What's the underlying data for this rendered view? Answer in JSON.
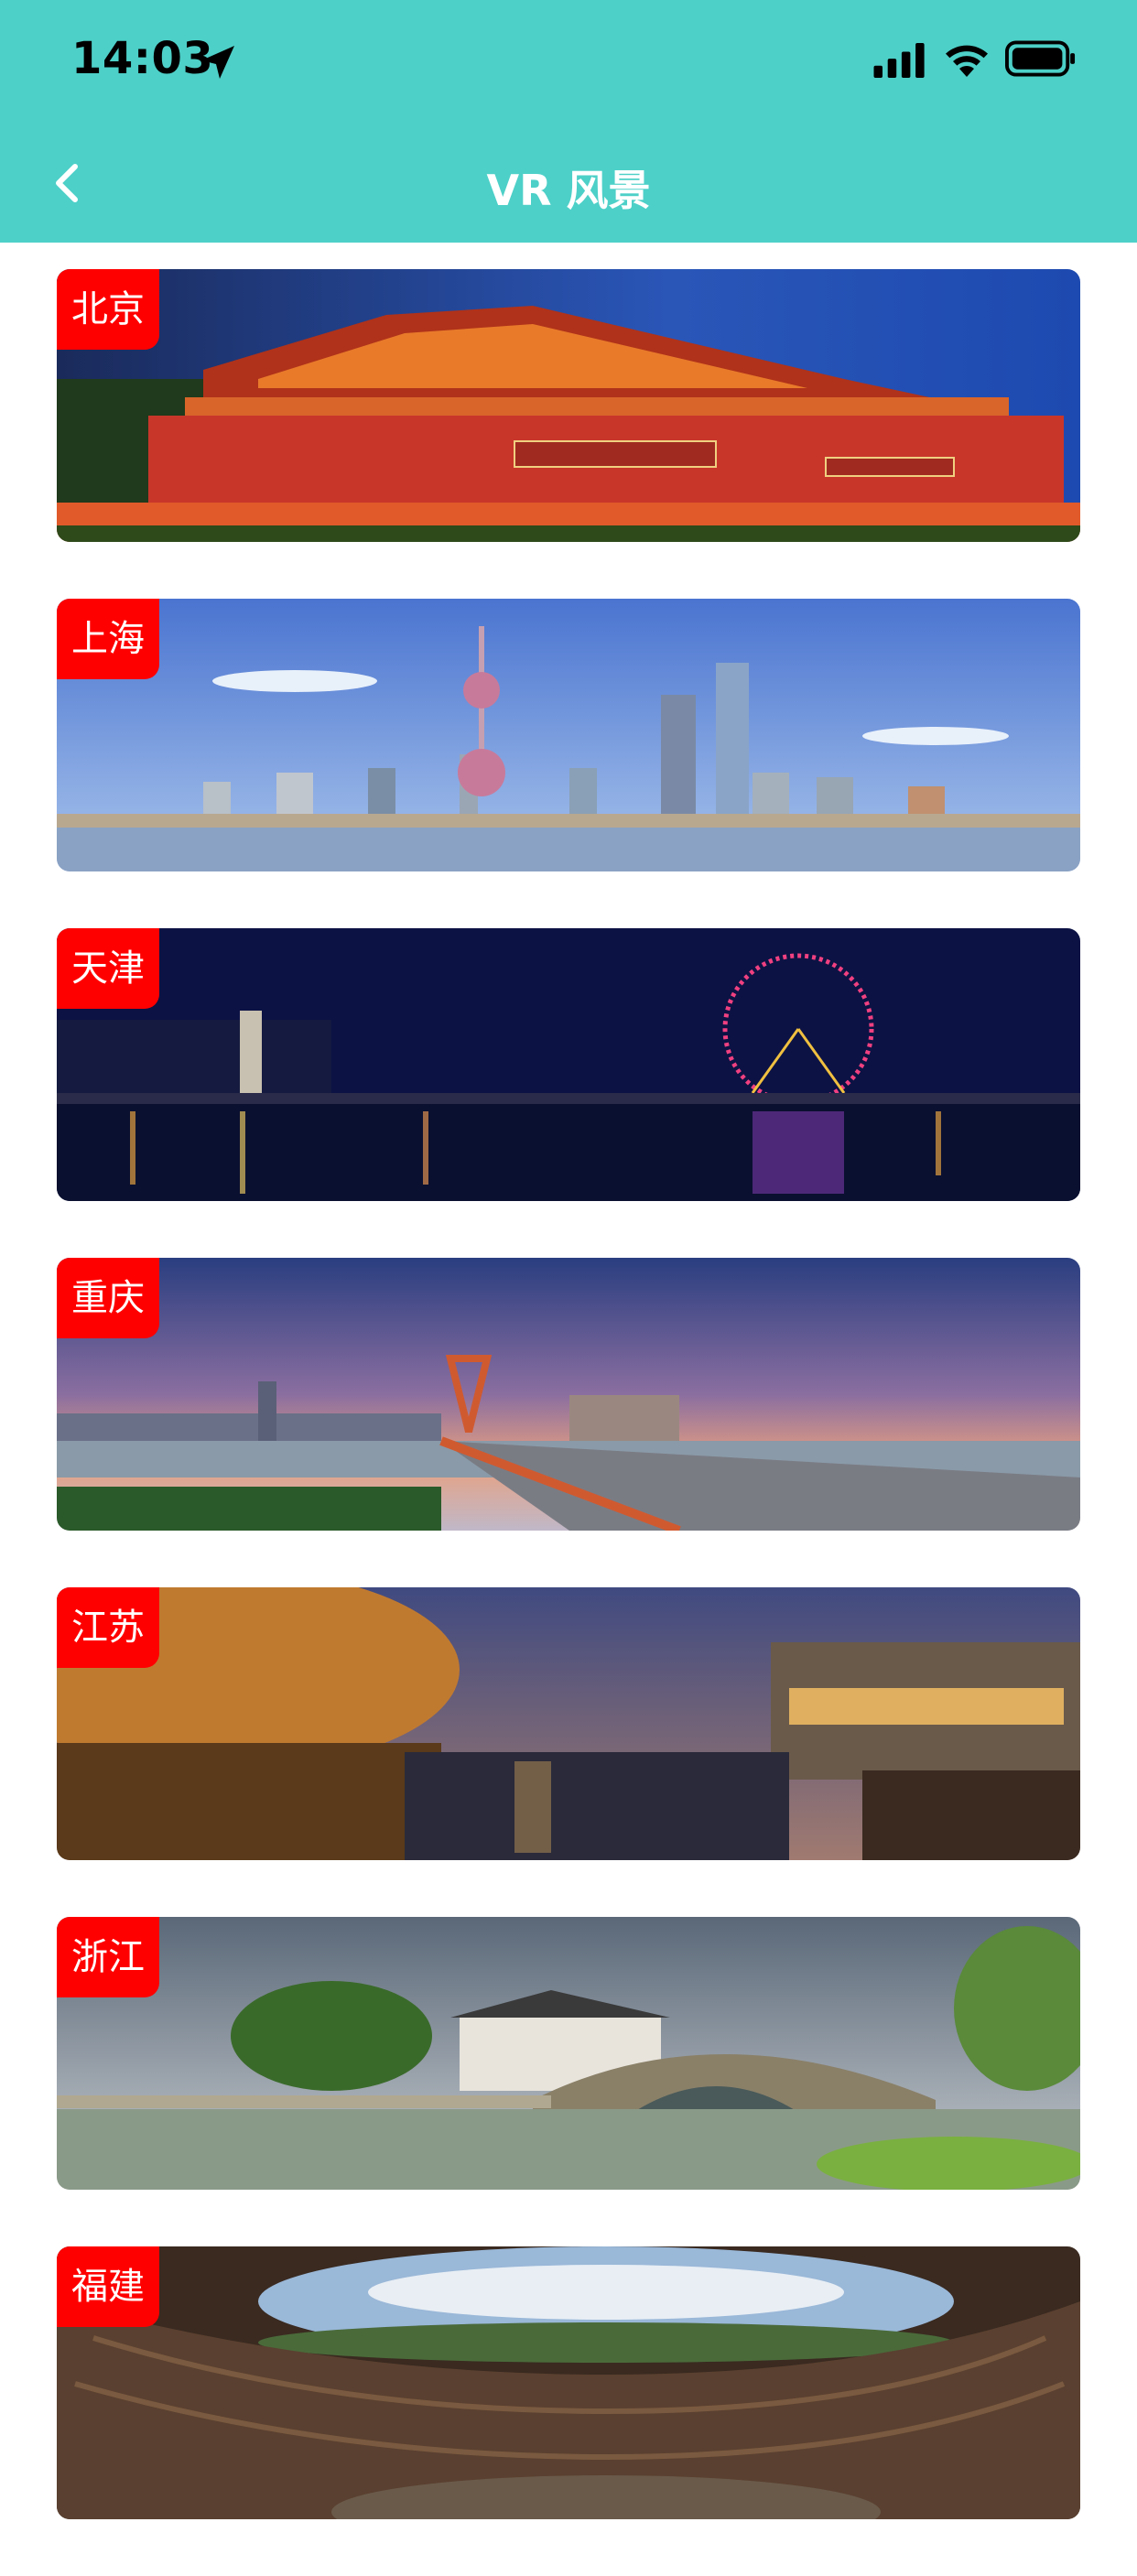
{
  "status": {
    "time": "14:03"
  },
  "nav": {
    "title": "VR 风景"
  },
  "cards": [
    {
      "label": "北京",
      "scene": "forbidden-city-gate"
    },
    {
      "label": "上海",
      "scene": "shanghai-skyline"
    },
    {
      "label": "天津",
      "scene": "tianjin-eye-night"
    },
    {
      "label": "重庆",
      "scene": "chongqing-bridge"
    },
    {
      "label": "江苏",
      "scene": "water-town-night"
    },
    {
      "label": "浙江",
      "scene": "stone-arch-bridge"
    },
    {
      "label": "福建",
      "scene": "tulou-courtyard"
    }
  ],
  "colors": {
    "header": "#4dd0c8",
    "tag": "#ff0000"
  }
}
